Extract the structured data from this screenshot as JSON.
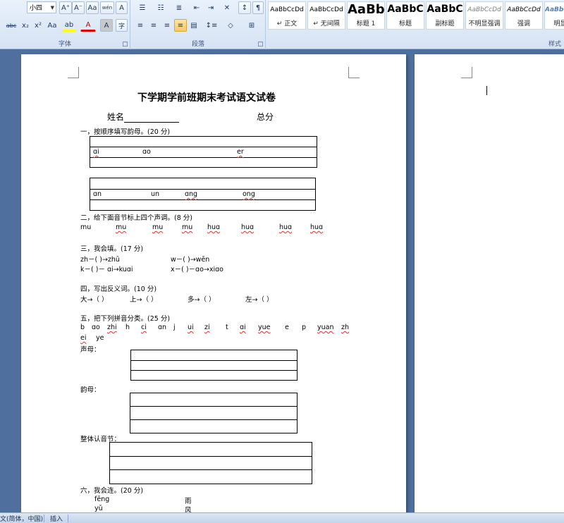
{
  "ribbon": {
    "font_size": "小四",
    "font_group_title": "字体",
    "paragraph_group_title": "段落",
    "styles_group_title": "样式",
    "font_buttons": {
      "grow": "A⁺",
      "shrink": "A⁻",
      "clear": "Aa",
      "phonetic": "wén",
      "border_char": "A",
      "strike": "abc",
      "subscript": "x₂",
      "superscript": "x²",
      "change_case": "Aa",
      "font_color": "A",
      "char_shading": "A",
      "enclose": "字"
    },
    "styles": [
      {
        "sample": "AaBbCcDd",
        "name": "↵ 正文"
      },
      {
        "sample": "AaBbCcDd",
        "name": "↵ 无间隔"
      },
      {
        "sample": "AaBb",
        "name": "标题 1"
      },
      {
        "sample": "AaBbC",
        "name": "标题"
      },
      {
        "sample": "AaBbC",
        "name": "副标题"
      },
      {
        "sample": "AaBbCcDd",
        "name": "不明显强调"
      },
      {
        "sample": "AaBbCcDd",
        "name": "强调"
      },
      {
        "sample": "AaBbCcDd",
        "name": "明显强"
      }
    ]
  },
  "document": {
    "title": "下学期学前班期末考试语文试卷",
    "name_label": "姓名",
    "total_label": "总分",
    "s1": {
      "heading": "一，按顺序填写韵母。(20 分)",
      "row1": [
        "ɑi",
        "ɑo",
        "er"
      ],
      "row2": [
        "ɑn",
        "un",
        "ɑng",
        "ong"
      ]
    },
    "s2": {
      "heading": "二，给下面音节标上四个声调。(8 分)",
      "items": [
        "mu",
        "mu",
        "mu",
        "mu",
        "huɑ",
        "huɑ",
        "huɑ",
        "huɑ"
      ]
    },
    "s3": {
      "heading": "三，我会填。(17 分)",
      "line1a": "zh－(    )→zhū",
      "line1b": "w－(    )→wēn",
      "line2a": "k－(   )－ ɑi→kuɑi",
      "line2b": "x－(    )－ɑo→xiɑo"
    },
    "s4": {
      "heading": "四，写出反义词。(10 分)",
      "items": [
        "大→（    ）",
        "上→（    ）",
        "多→（    ）",
        "左→（    ）"
      ]
    },
    "s5": {
      "heading": "五，把下列拼音分类。(25 分)",
      "letters": [
        "b",
        "ɑo",
        "zhi",
        "h",
        "ci",
        "ɑn",
        "j",
        "ui",
        "zi",
        "t",
        "ɑi",
        "yue",
        "e",
        "p",
        "yuan",
        "zh"
      ],
      "letters2": [
        "ei",
        "ye"
      ],
      "shengmu": "声母：",
      "yunmu": "韵母：",
      "zhengti": "整体认音节："
    },
    "s6": {
      "heading": "六，我会连。(20 分)",
      "left": [
        "fēng",
        "yǔ"
      ],
      "right": [
        "雨",
        "风"
      ]
    }
  },
  "status": {
    "language": "文(简体，中国)",
    "mode": "插入"
  }
}
